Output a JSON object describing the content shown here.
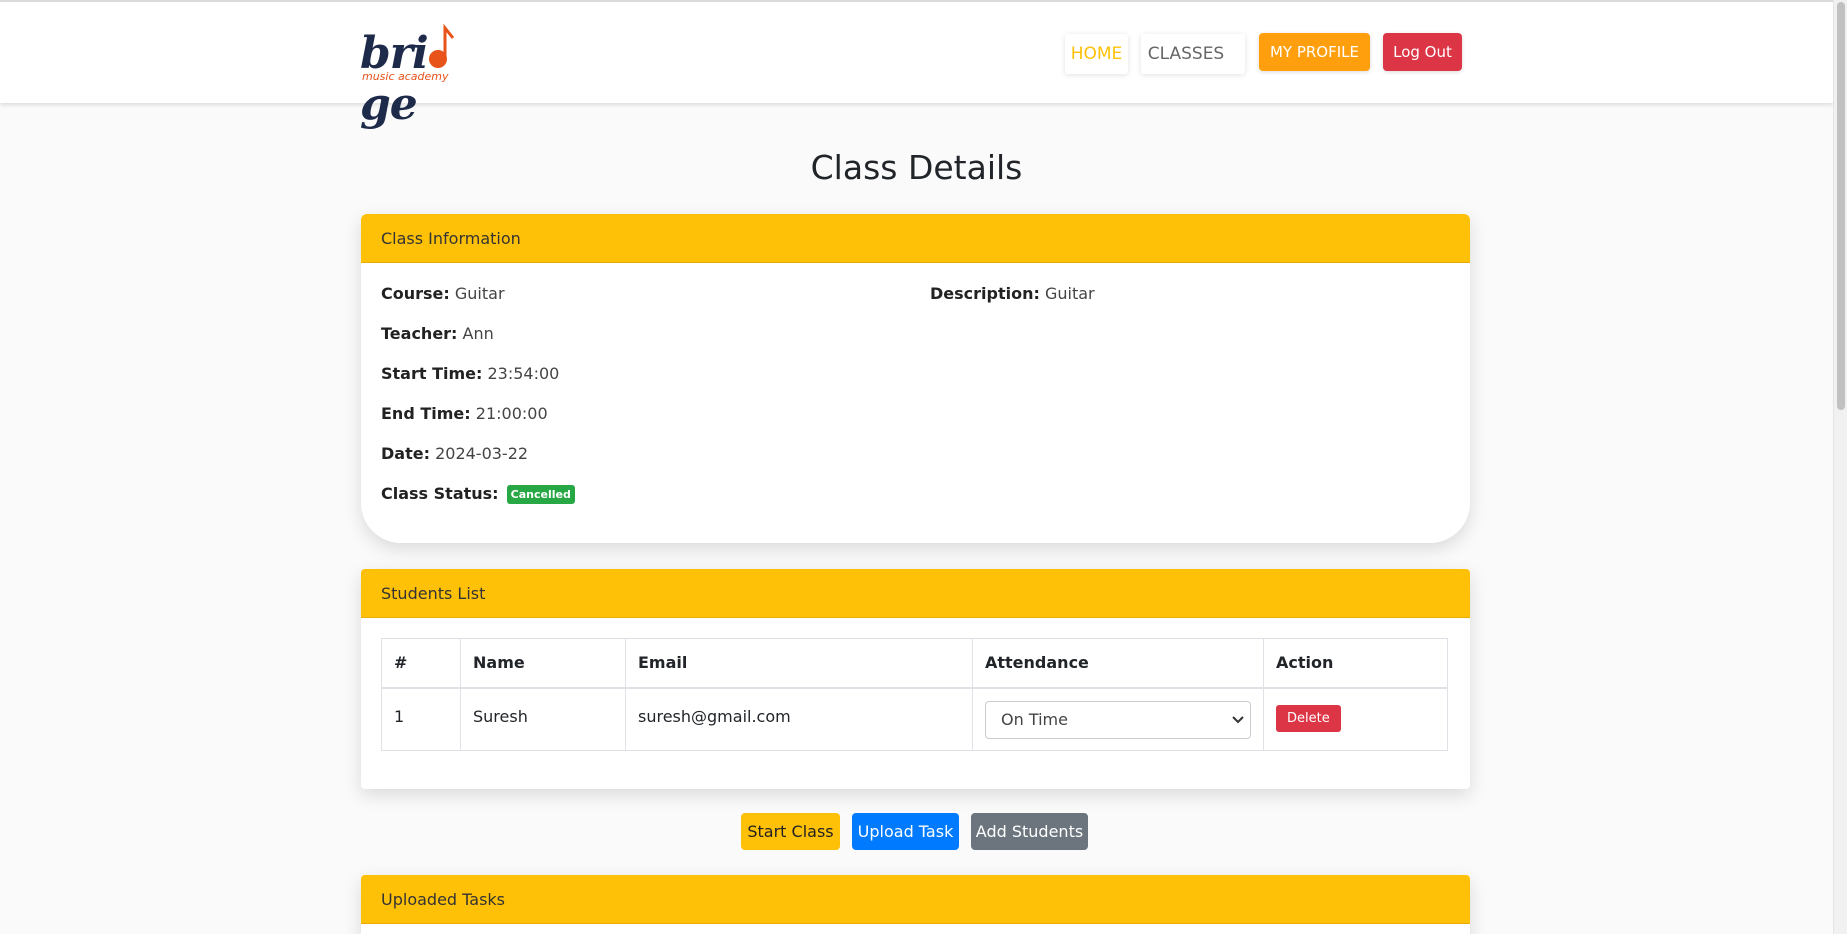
{
  "nav": {
    "logo_text": "bri  ge",
    "logo_sub": "music academy",
    "home": "HOME",
    "classes": "CLASSES",
    "profile": "MY PROFILE",
    "logout": "Log Out"
  },
  "page": {
    "title": "Class Details"
  },
  "class_info": {
    "header": "Class Information",
    "course_label": "Course:",
    "course": "Guitar",
    "description_label": "Description:",
    "description": "Guitar",
    "teacher_label": "Teacher:",
    "teacher": "Ann",
    "start_label": "Start Time:",
    "start_time": "23:54:00",
    "end_label": "End Time:",
    "end_time": "21:00:00",
    "date_label": "Date:",
    "date": "2024-03-22",
    "status_label": "Class Status:",
    "status": "Cancelled"
  },
  "students": {
    "header": "Students List",
    "columns": [
      "#",
      "Name",
      "Email",
      "Attendance",
      "Action"
    ],
    "rows": [
      {
        "num": "1",
        "name": "Suresh",
        "email": "suresh@gmail.com",
        "attendance": "On Time",
        "action": "Delete"
      }
    ]
  },
  "actions": {
    "start": "Start Class",
    "upload": "Upload Task",
    "add": "Add Students"
  },
  "tasks": {
    "header": "Uploaded Tasks"
  },
  "colors": {
    "accent": "#ffc107",
    "danger": "#dc3545",
    "primary": "#007bff",
    "secondary": "#6c757d",
    "success": "#28a745",
    "profile": "#ff9f0e"
  }
}
